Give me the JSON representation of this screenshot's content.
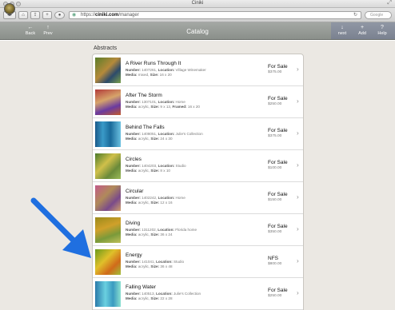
{
  "window": {
    "title": "Ciniki"
  },
  "browser": {
    "url_scheme": "https://",
    "url_host": "ciniki.com",
    "url_path": "/manager",
    "search_placeholder": "Google"
  },
  "nav": {
    "title": "Catalog",
    "back_label": "Back",
    "prev_label": "Prev",
    "next_label": "next",
    "add_label": "Add",
    "help_label": "Help"
  },
  "section": {
    "title": "Abstracts"
  },
  "items": [
    {
      "title": "A River Runs Through It",
      "number": "1407261",
      "location": "Village Winemaker",
      "media": "mixed",
      "size": "16 x 20",
      "framed": "",
      "status": "For Sale",
      "price": "$375.00"
    },
    {
      "title": "After The Storm",
      "number": "1307101",
      "location": "Home",
      "media": "acrylic",
      "size": "9 x 13",
      "framed": "16 x 20",
      "status": "For Sale",
      "price": "$250.00"
    },
    {
      "title": "Behind The Falls",
      "number": "1408051",
      "location": "Julie's Collection",
      "media": "acrylic",
      "size": "24 x 30",
      "framed": "",
      "status": "For Sale",
      "price": "$375.00"
    },
    {
      "title": "Circles",
      "number": "1404203",
      "location": "Studio",
      "media": "acrylic",
      "size": "8 x 10",
      "framed": "",
      "status": "For Sale",
      "price": "$100.00"
    },
    {
      "title": "Circular",
      "number": "1402242",
      "location": "Home",
      "media": "acrylic",
      "size": "12 x 16",
      "framed": "",
      "status": "For Sale",
      "price": "$150.00"
    },
    {
      "title": "Diving",
      "number": "1311202",
      "location": "Florida home",
      "media": "acrylic",
      "size": "36 x 24",
      "framed": "",
      "status": "For Sale",
      "price": "$350.00"
    },
    {
      "title": "Energy",
      "number": "141041",
      "location": "Studio",
      "media": "acrylic",
      "size": "36 x 48",
      "framed": "",
      "status": "NFS",
      "price": "$800.00"
    },
    {
      "title": "Falling Water",
      "number": "140513",
      "location": "Julie's Collection",
      "media": "acrylic",
      "size": "22 x 28",
      "framed": "",
      "status": "For Sale",
      "price": "$250.00"
    }
  ],
  "labels": {
    "number": "Number:",
    "location": "Location:",
    "media": "Media:",
    "size": "Size:",
    "framed": "Framed:"
  },
  "colors": {
    "annotation_arrow": "#1f6fe0",
    "nav_bar": "#8f948f",
    "content_bg": "#ebe8e3"
  }
}
